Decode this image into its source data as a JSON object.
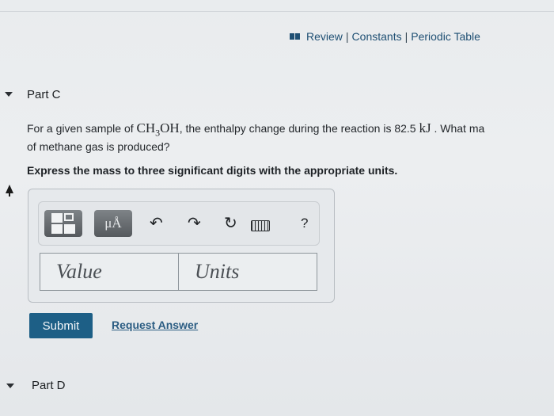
{
  "header": {
    "links": [
      "Review",
      "Constants",
      "Periodic Table"
    ],
    "separator": "|"
  },
  "part_c": {
    "title": "Part C",
    "question_prefix": "For a given sample of ",
    "formula_pre": "CH",
    "formula_sub": "3",
    "formula_post": "OH",
    "question_mid": ", the enthalpy change during the reaction is 82.5 ",
    "unit": "kJ",
    "question_suffix": " . What ma",
    "question_line2": "of methane gas is produced?",
    "instruction": "Express the mass to three significant digits with the appropriate units."
  },
  "toolbar": {
    "units_button_label": "μÅ",
    "undo_icon": "↶",
    "redo_icon": "↷",
    "reset_icon": "↻",
    "help_label": "?"
  },
  "inputs": {
    "value_placeholder": "Value",
    "units_placeholder": "Units"
  },
  "actions": {
    "submit_label": "Submit",
    "request_answer_label": "Request Answer"
  },
  "part_d": {
    "title": "Part D"
  },
  "colors": {
    "accent": "#1d5f86",
    "link": "#1f4f73"
  }
}
